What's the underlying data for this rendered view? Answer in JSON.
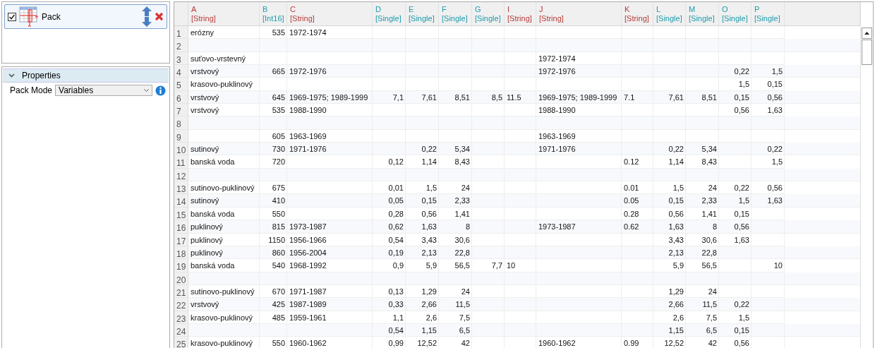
{
  "layers": {
    "items": [
      {
        "name": "Pack",
        "checked": true,
        "selected": true
      }
    ]
  },
  "properties": {
    "title": "Properties",
    "expanded": true,
    "fields": [
      {
        "label": "Pack Mode",
        "value": "Variables"
      }
    ]
  },
  "table": {
    "columns": [
      {
        "letter": "A",
        "type": "[String]",
        "kind": "text"
      },
      {
        "letter": "B",
        "type": "[Int16]",
        "kind": "number"
      },
      {
        "letter": "C",
        "type": "[String]",
        "kind": "text"
      },
      {
        "letter": "D",
        "type": "[Single]",
        "kind": "number"
      },
      {
        "letter": "E",
        "type": "[Single]",
        "kind": "number"
      },
      {
        "letter": "F",
        "type": "[Single]",
        "kind": "number"
      },
      {
        "letter": "G",
        "type": "[Single]",
        "kind": "number"
      },
      {
        "letter": "I",
        "type": "[String]",
        "kind": "text"
      },
      {
        "letter": "J",
        "type": "[String]",
        "kind": "text"
      },
      {
        "letter": "K",
        "type": "[String]",
        "kind": "text"
      },
      {
        "letter": "L",
        "type": "[Single]",
        "kind": "number"
      },
      {
        "letter": "M",
        "type": "[Single]",
        "kind": "number"
      },
      {
        "letter": "O",
        "type": "[Single]",
        "kind": "number"
      },
      {
        "letter": "P",
        "type": "[Single]",
        "kind": "number"
      }
    ],
    "rows": [
      {
        "number": "1",
        "cells": [
          "erózny",
          "535",
          "1972-1974",
          null,
          null,
          null,
          null,
          null,
          null,
          null,
          null,
          null,
          null,
          null
        ]
      },
      {
        "number": "2",
        "cells": [
          null,
          null,
          null,
          null,
          null,
          null,
          null,
          null,
          null,
          null,
          null,
          null,
          null,
          null
        ]
      },
      {
        "number": "3",
        "cells": [
          "suťovo-vrstevný",
          null,
          null,
          null,
          null,
          null,
          null,
          null,
          "1972-1974",
          null,
          null,
          null,
          null,
          null
        ]
      },
      {
        "number": "4",
        "cells": [
          "vrstvový",
          "665",
          "1972-1976",
          null,
          null,
          null,
          null,
          null,
          "1972-1976",
          null,
          null,
          null,
          "0,22",
          "1,5"
        ]
      },
      {
        "number": "5",
        "cells": [
          "krasovo-puklinový",
          null,
          null,
          null,
          null,
          null,
          null,
          null,
          null,
          null,
          null,
          null,
          "1,5",
          "0,15"
        ]
      },
      {
        "number": "6",
        "cells": [
          "vrstvový",
          "645",
          "1969-1975; 1989-1999",
          "7,1",
          "7,61",
          "8,51",
          "8,5",
          "11.5",
          "1969-1975; 1989-1999",
          "7.1",
          "7,61",
          "8,51",
          "0,15",
          "0,56"
        ]
      },
      {
        "number": "7",
        "cells": [
          "vrstvový",
          "535",
          "1988-1990",
          null,
          null,
          null,
          null,
          null,
          "1988-1990",
          null,
          null,
          null,
          "0,56",
          "1,63"
        ]
      },
      {
        "number": "8",
        "cells": [
          null,
          null,
          null,
          null,
          null,
          null,
          null,
          null,
          null,
          null,
          null,
          null,
          null,
          null
        ]
      },
      {
        "number": "9",
        "cells": [
          null,
          "605",
          "1963-1969",
          null,
          null,
          null,
          null,
          null,
          "1963-1969",
          null,
          null,
          null,
          null,
          null
        ]
      },
      {
        "number": "10",
        "cells": [
          "sutinový",
          "730",
          "1971-1976",
          null,
          "0,22",
          "5,34",
          null,
          null,
          "1971-1976",
          null,
          "0,22",
          "5,34",
          null,
          "0,22"
        ]
      },
      {
        "number": "11",
        "cells": [
          "banská voda",
          "720",
          null,
          "0,12",
          "1,14",
          "8,43",
          null,
          null,
          null,
          "0.12",
          "1,14",
          "8,43",
          null,
          "1,5"
        ]
      },
      {
        "number": "12",
        "cells": [
          null,
          null,
          null,
          null,
          null,
          null,
          null,
          null,
          null,
          null,
          null,
          null,
          null,
          null
        ]
      },
      {
        "number": "13",
        "cells": [
          "sutinovo-puklinový",
          "675",
          null,
          "0,01",
          "1,5",
          "24",
          null,
          null,
          null,
          "0.01",
          "1,5",
          "24",
          "0,22",
          "0,56"
        ]
      },
      {
        "number": "14",
        "cells": [
          "sutinový",
          "410",
          null,
          "0,05",
          "0,15",
          "2,33",
          null,
          null,
          null,
          "0.05",
          "0,15",
          "2,33",
          "1,5",
          "1,63"
        ]
      },
      {
        "number": "15",
        "cells": [
          "banská voda",
          "550",
          null,
          "0,28",
          "0,56",
          "1,41",
          null,
          null,
          null,
          "0.28",
          "0,56",
          "1,41",
          "0,15",
          null
        ]
      },
      {
        "number": "16",
        "cells": [
          "puklinový",
          "815",
          "1973-1987",
          "0,62",
          "1,63",
          "8",
          null,
          null,
          "1973-1987",
          "0.62",
          "1,63",
          "8",
          "0,56",
          null
        ]
      },
      {
        "number": "17",
        "cells": [
          "puklinový",
          "1150",
          "1956-1966",
          "0,54",
          "3,43",
          "30,6",
          null,
          null,
          null,
          null,
          "3,43",
          "30,6",
          "1,63",
          null
        ]
      },
      {
        "number": "18",
        "cells": [
          "puklinový",
          "860",
          "1956-2004",
          "0,19",
          "2,13",
          "22,8",
          null,
          null,
          null,
          null,
          "2,13",
          "22,8",
          null,
          null
        ]
      },
      {
        "number": "19",
        "cells": [
          "banská voda",
          "540",
          "1968-1992",
          "0,9",
          "5,9",
          "56,5",
          "7,7",
          "10",
          null,
          null,
          "5,9",
          "56,5",
          null,
          "10"
        ]
      },
      {
        "number": "20",
        "cells": [
          null,
          null,
          null,
          null,
          null,
          null,
          null,
          null,
          null,
          null,
          null,
          null,
          null,
          null
        ]
      },
      {
        "number": "21",
        "cells": [
          "sutinovo-puklinový",
          "670",
          "1971-1987",
          "0,13",
          "1,29",
          "24",
          null,
          null,
          null,
          null,
          "1,29",
          "24",
          null,
          null
        ]
      },
      {
        "number": "22",
        "cells": [
          "vrstvový",
          "425",
          "1987-1989",
          "0,33",
          "2,66",
          "11,5",
          null,
          null,
          null,
          null,
          "2,66",
          "11,5",
          "0,22",
          null
        ]
      },
      {
        "number": "23",
        "cells": [
          "krasovo-puklinový",
          "485",
          "1959-1961",
          "1,1",
          "2,6",
          "7,5",
          null,
          null,
          null,
          null,
          "2,6",
          "7,5",
          "1,5",
          null
        ]
      },
      {
        "number": "24",
        "cells": [
          null,
          null,
          null,
          "0,54",
          "1,15",
          "6,5",
          null,
          null,
          null,
          null,
          "1,15",
          "6,5",
          "0,15",
          null
        ]
      },
      {
        "number": "25",
        "cells": [
          "krasovo-puklinový",
          "550",
          "1960-1962",
          "0,99",
          "12,52",
          "42",
          null,
          null,
          "1960-1962",
          "0.99",
          "12,52",
          "42",
          "0,56",
          null
        ]
      }
    ]
  }
}
